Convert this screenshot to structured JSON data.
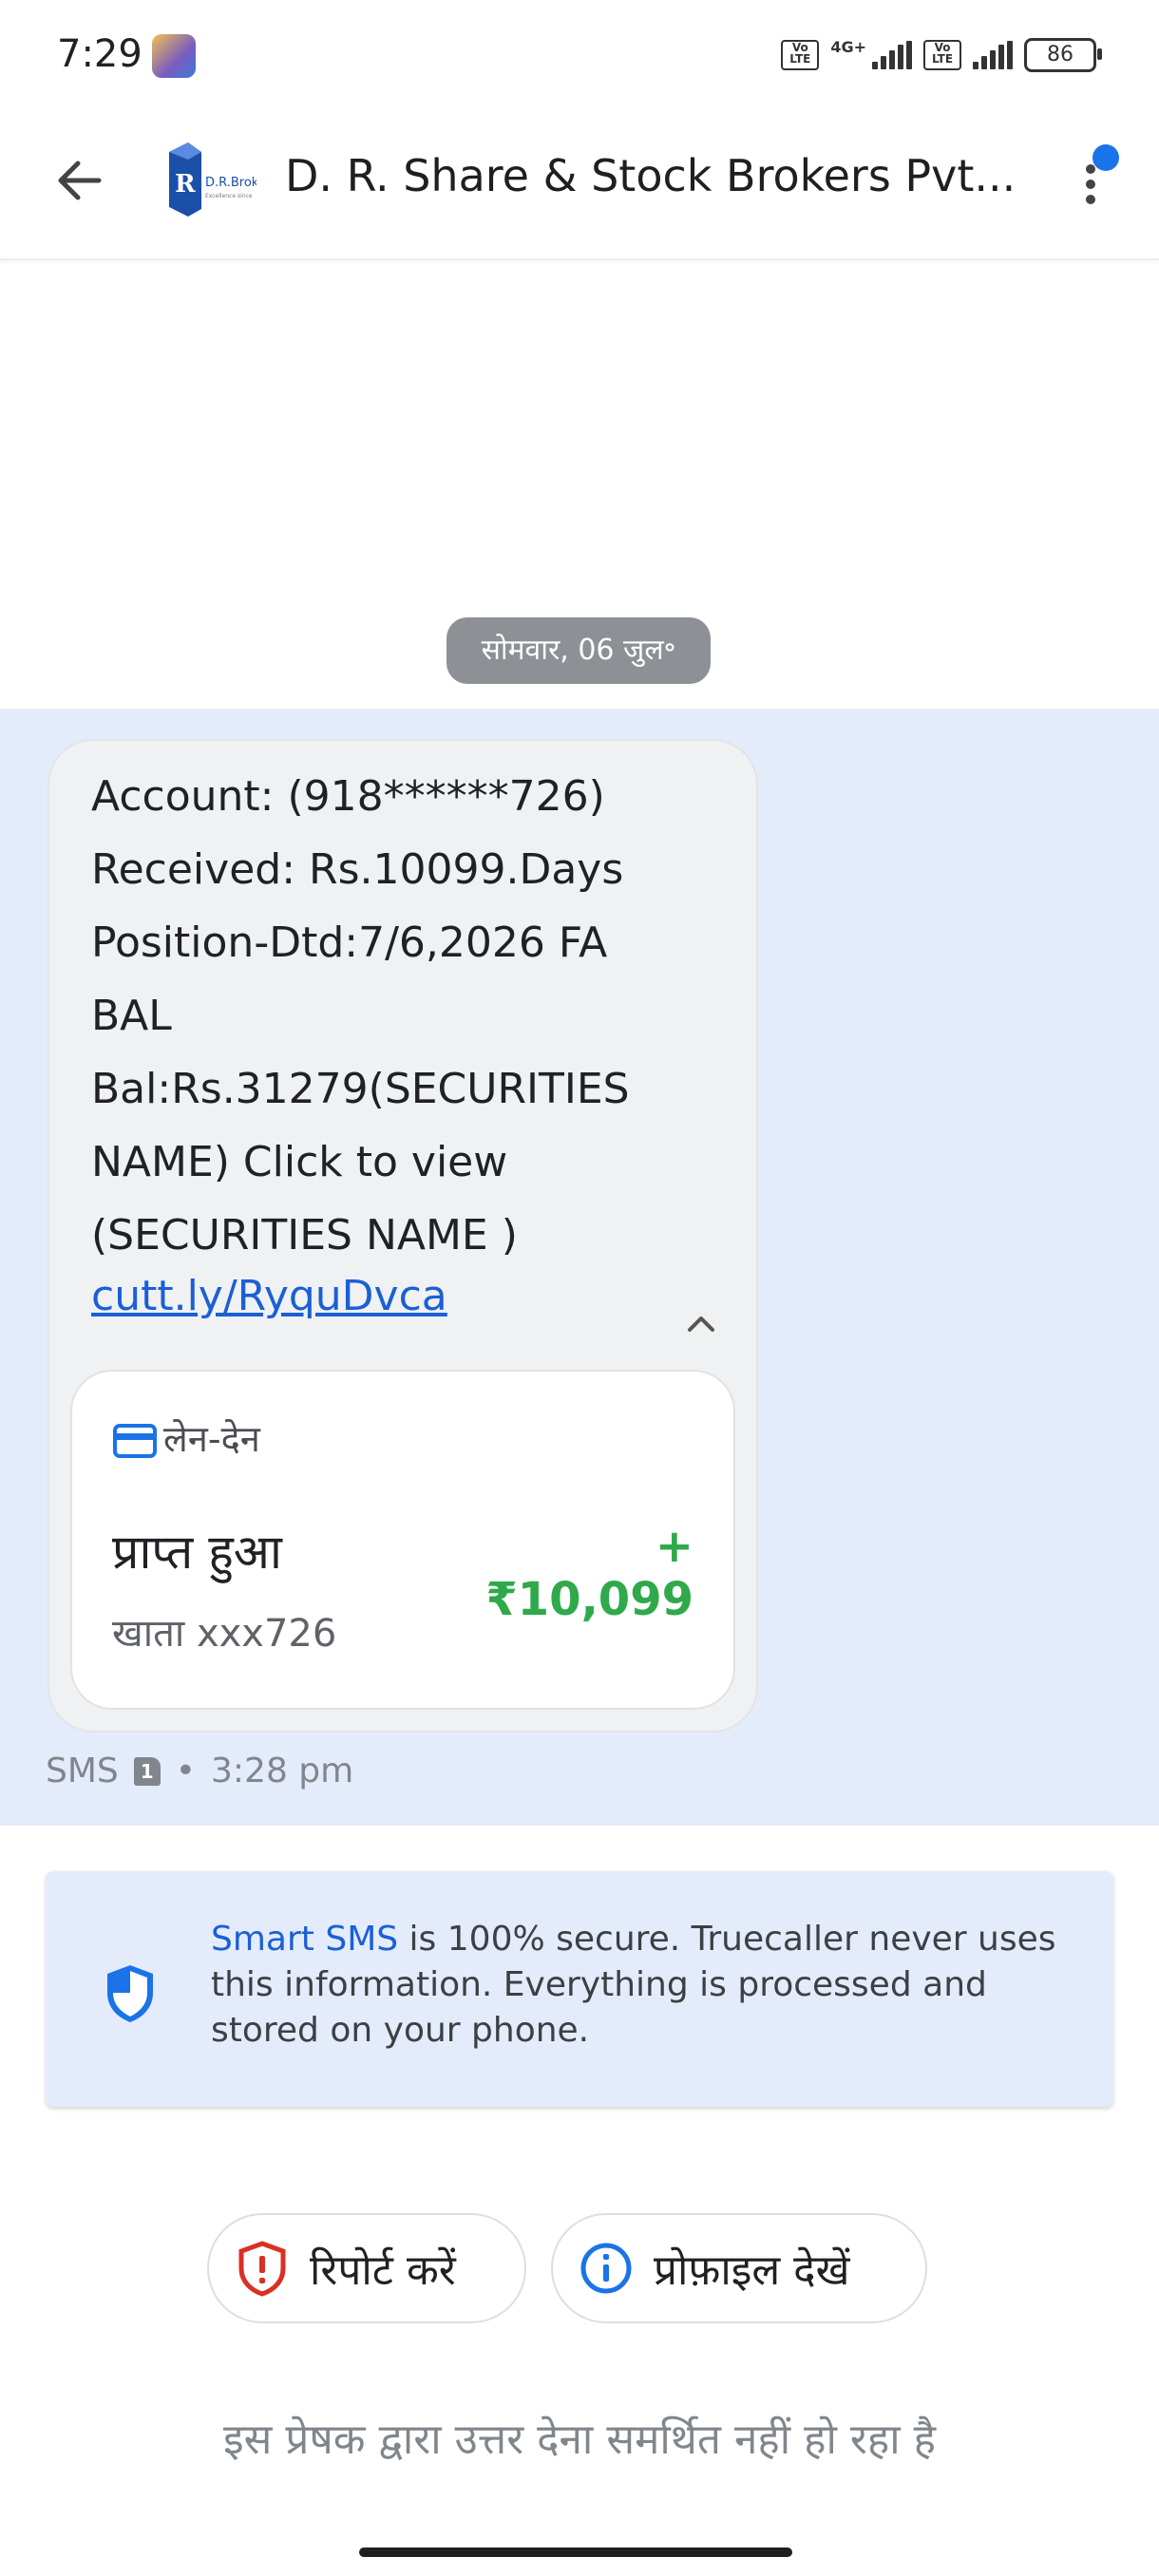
{
  "status_bar": {
    "time": "7:29",
    "network_label": "4G+",
    "volte_label": "Vo LTE",
    "battery": "86"
  },
  "header": {
    "sender_name": "D. R. Share & Stock Brokers Pvt...",
    "logo_text": "D.R.Brokers"
  },
  "date_chip": "सोमवार, 06 जुल॰",
  "message": {
    "lines": [
      "Account: (918******726)",
      "Received: Rs.10099.Days",
      "Position-Dtd:7/6,2026 FA",
      "BAL",
      "Bal:Rs.31279(SECURITIES",
      "NAME) Click to view",
      "(SECURITIES NAME )"
    ],
    "link": "cutt.ly/RyquDvca"
  },
  "transaction": {
    "label": "लेन-देन",
    "title": "प्राप्त हुआ",
    "amount": "+ ₹10,099",
    "account": "खाता xxx726"
  },
  "meta": {
    "channel": "SMS",
    "sim": "1",
    "separator": "•",
    "time": "3:28 pm"
  },
  "secure_notice": {
    "brand": "Smart SMS",
    "text": " is 100% secure. Truecaller never uses this information. Everything is processed and stored on your phone."
  },
  "actions": {
    "report_label": "रिपोर्ट करें",
    "profile_label": "प्रोफ़ाइल देखें"
  },
  "footer_note": "इस प्रेषक द्वारा उत्तर देना समर्थित नहीं हो रहा है",
  "colors": {
    "accent": "#1a73e8",
    "highlight": "#e4ecfb",
    "amount_green": "#2fa94a",
    "report_red": "#d93025"
  }
}
